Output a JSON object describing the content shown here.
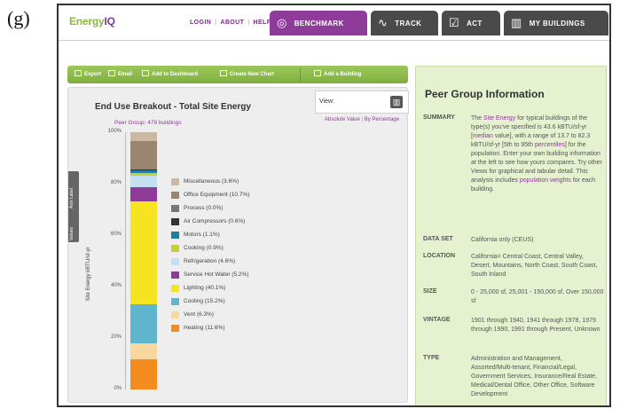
{
  "figure_label": "(g)",
  "nav": {
    "logo_prefix": "Energy",
    "logo_suffix": "IQ",
    "login": "LOGIN",
    "about": "ABOUT",
    "help": "HELP",
    "tabs": [
      {
        "label": "BENCHMARK",
        "icon": "benchmark-icon",
        "glyph": "◎"
      },
      {
        "label": "TRACK",
        "icon": "track-icon",
        "glyph": "∿"
      },
      {
        "label": "ACT",
        "icon": "act-icon",
        "glyph": "☑"
      },
      {
        "label": "MY BUILDINGS",
        "icon": "buildings-icon",
        "glyph": "▥"
      }
    ]
  },
  "toolbar": {
    "export": "Export",
    "email": "Email",
    "add_dashboard": "Add to Dashboard",
    "create_chart": "Create New Chart",
    "add_building": "Add a Building"
  },
  "view": {
    "label": "View:",
    "absolute": "Absolute Value",
    "percentage": "By Percentage"
  },
  "side_tabs": {
    "a": "Axis Label",
    "b": "Values"
  },
  "chart_data": {
    "type": "bar",
    "title": "End Use Breakout - Total Site Energy",
    "subtitle": "Peer Group: 478 buildings",
    "ylabel": "Site Energy kBTU/sf-yr",
    "yticks": [
      "0%",
      "20%",
      "40%",
      "60%",
      "80%",
      "100%"
    ],
    "ylim": [
      0,
      100
    ],
    "stacked": true,
    "series": [
      {
        "name": "Heating",
        "pct": 11.6,
        "color": "#f28c1e",
        "legend": "Heating (11.6%)"
      },
      {
        "name": "Vent",
        "pct": 6.3,
        "color": "#f9d8a0",
        "legend": "Vent (6.3%)"
      },
      {
        "name": "Cooling",
        "pct": 15.2,
        "color": "#5fb6cc",
        "legend": "Cooling (15.2%)"
      },
      {
        "name": "Lighting",
        "pct": 40.1,
        "color": "#f6e421",
        "legend": "Lighting (40.1%)"
      },
      {
        "name": "Service Hot Water",
        "pct": 5.2,
        "color": "#8e3a98",
        "legend": "Service Hot Water (5.2%)"
      },
      {
        "name": "Refrigeration",
        "pct": 4.6,
        "color": "#c4dff0",
        "legend": "Refrigeration (4.6%)"
      },
      {
        "name": "Cooking",
        "pct": 0.9,
        "color": "#c3d132",
        "legend": "Cooking (0.9%)"
      },
      {
        "name": "Motors",
        "pct": 1.1,
        "color": "#1f7fa8",
        "legend": "Motors (1.1%)"
      },
      {
        "name": "Air Compressors",
        "pct": 0.6,
        "color": "#333333",
        "legend": "Air Compressors (0.6%)"
      },
      {
        "name": "Process",
        "pct": 0.0,
        "color": "#777777",
        "legend": "Process (0.0%)"
      },
      {
        "name": "Office Equipment",
        "pct": 10.7,
        "color": "#9a8571",
        "legend": "Office Equipment (10.7%)"
      },
      {
        "name": "Miscellaneous",
        "pct": 3.6,
        "color": "#cbb9a0",
        "legend": "Miscellaneous (3.6%)"
      }
    ]
  },
  "info": {
    "title": "Peer Group Information",
    "rows": [
      {
        "key": "SUMMARY",
        "parts": [
          {
            "t": "The "
          },
          {
            "t": "Site Energy",
            "hl": true
          },
          {
            "t": " for typical buildings of the type(s) you've specified is 43.6 kBTU/sf-yr ["
          },
          {
            "t": "median",
            "hl": true
          },
          {
            "t": " value], with a range of 13.7 to 82.3 kBTU/sf-yr [5th to 95th "
          },
          {
            "t": "percentiles",
            "hl": true
          },
          {
            "t": "] for the population. Enter your own building information at the left to see how yours compares. Try other Views for graphical and tabular detail. This analysis includes "
          },
          {
            "t": "population weights",
            "hl": true
          },
          {
            "t": " for each building."
          }
        ]
      },
      {
        "key": "DATA SET",
        "parts": [
          {
            "t": "California only (CEUS)"
          }
        ]
      },
      {
        "key": "LOCATION",
        "parts": [
          {
            "t": "California= Central Coast, Central Valley, Desert, Mountains, North Coast, South Coast, South Inland"
          }
        ]
      },
      {
        "key": "SIZE",
        "parts": [
          {
            "t": "0 - 25,000 sf, 25,001 - 150,000 sf, Over 150,000 sf"
          }
        ]
      },
      {
        "key": "VINTAGE",
        "parts": [
          {
            "t": "1901 through 1940, 1941 through 1978, 1979 through 1990, 1991 through Present, Unknown"
          }
        ]
      },
      {
        "key": "TYPE",
        "parts": [
          {
            "t": "Administration and Management, Assorted/Multi-tenant, Financial/Legal, Government Services, Insurance/Real Estate, Medical/Dental Office, Other Office, Software Development"
          }
        ]
      }
    ]
  }
}
